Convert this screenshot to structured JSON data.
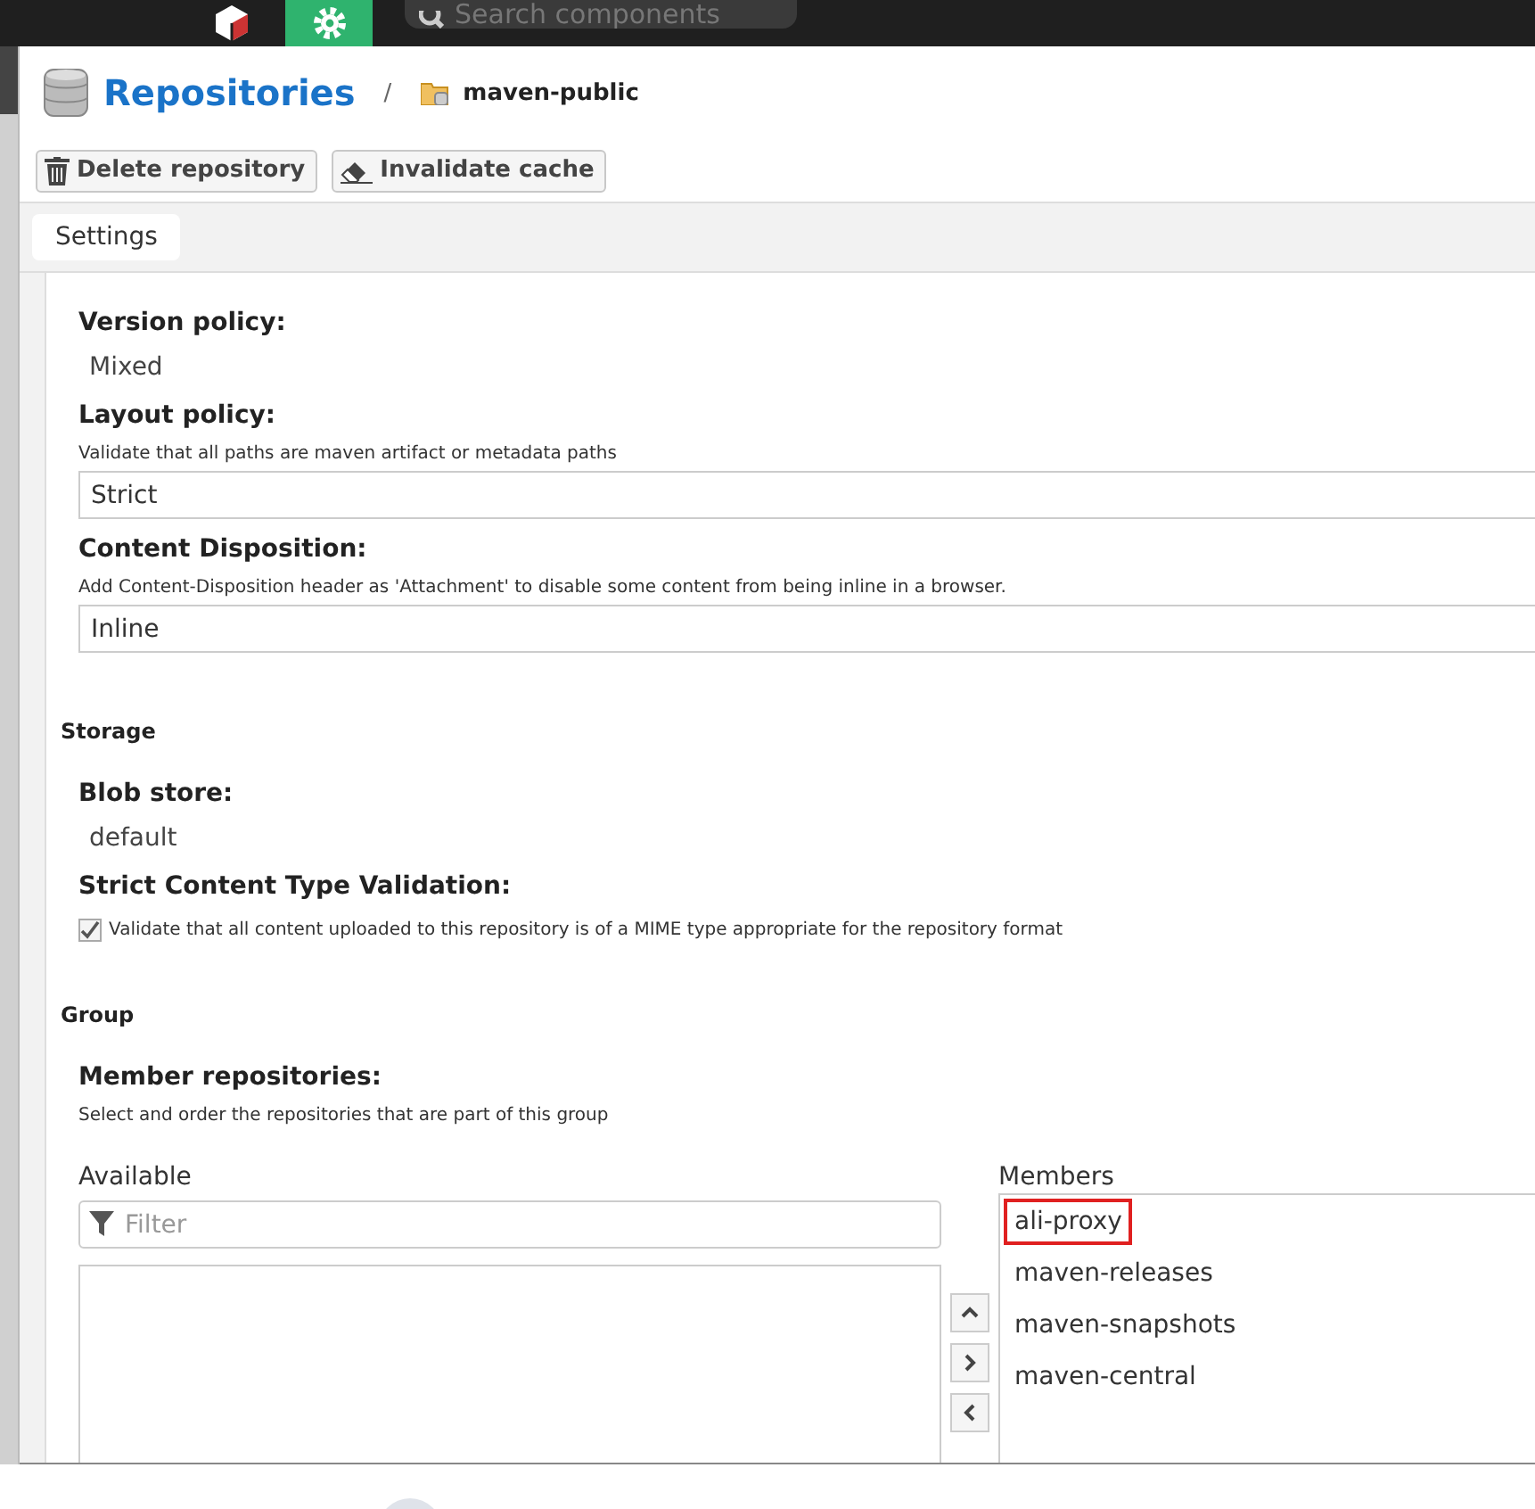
{
  "topbar": {
    "search": {
      "placeholder": "Search components"
    }
  },
  "header": {
    "title": "Repositories",
    "separator": "/",
    "repository": "maven-public"
  },
  "toolbar": {
    "buttons": [
      {
        "kind": "delete",
        "label": "Delete repository"
      },
      {
        "kind": "invalidate",
        "label": "Invalidate cache"
      }
    ]
  },
  "tabs": [
    {
      "label": "Settings",
      "selected": true
    }
  ],
  "maven": {
    "version_policy": {
      "label": "Version policy:",
      "value": "Mixed"
    },
    "layout_policy": {
      "label": "Layout policy:",
      "help": "Validate that all paths are maven artifact or metadata paths",
      "value": "Strict"
    },
    "content_disposition": {
      "label": "Content Disposition:",
      "help": "Add Content-Disposition header as 'Attachment' to disable some content from being inline in a browser.",
      "value": "Inline"
    }
  },
  "storage": {
    "heading": "Storage",
    "blob_store": {
      "label": "Blob store:",
      "value": "default"
    },
    "strict_validation": {
      "label": "Strict Content Type Validation:",
      "checked": true,
      "text": "Validate that all content uploaded to this repository is of a MIME type appropriate for the repository format"
    }
  },
  "group": {
    "heading": "Group",
    "label": "Member repositories:",
    "help": "Select and order the repositories that are part of this group",
    "available_label": "Available",
    "filter": {
      "placeholder": "Filter"
    },
    "members_label": "Members",
    "members": [
      {
        "name": "ali-proxy",
        "highlighted": true
      },
      {
        "name": "maven-releases",
        "highlighted": false
      },
      {
        "name": "maven-snapshots",
        "highlighted": false
      },
      {
        "name": "maven-central",
        "highlighted": false
      }
    ]
  }
}
